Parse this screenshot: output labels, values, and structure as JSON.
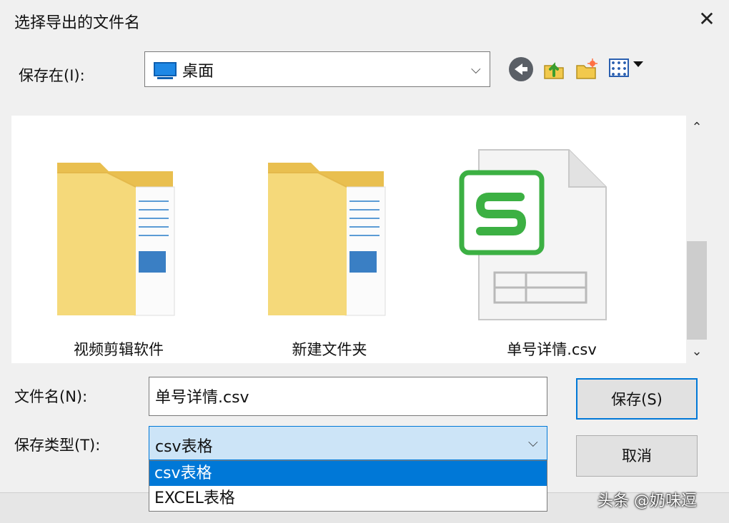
{
  "dialog": {
    "title": "选择导出的文件名",
    "close_symbol": "✕"
  },
  "look_in": {
    "label": "保存在(I):",
    "value": "桌面",
    "icon": "desktop-icon"
  },
  "toolbar": {
    "icons": [
      "back-icon",
      "up-folder-icon",
      "new-folder-icon",
      "view-menu-icon"
    ]
  },
  "files": [
    {
      "name": "视频剪辑软件",
      "type": "folder"
    },
    {
      "name": "新建文件夹",
      "type": "folder"
    },
    {
      "name": "单号详情.csv",
      "type": "csv"
    }
  ],
  "filename": {
    "label": "文件名(N):",
    "value": "单号详情.csv"
  },
  "filetype": {
    "label": "保存类型(T):",
    "value": "csv表格",
    "options": [
      "csv表格",
      "EXCEL表格"
    ]
  },
  "buttons": {
    "save": "保存(S)",
    "cancel": "取消"
  },
  "watermark": "头条 @奶味逗",
  "colors": {
    "accent": "#0078d7",
    "selection_bg": "#cce4f7",
    "csv_green": "#3cb043",
    "folder_yellow": "#f5d97a"
  }
}
